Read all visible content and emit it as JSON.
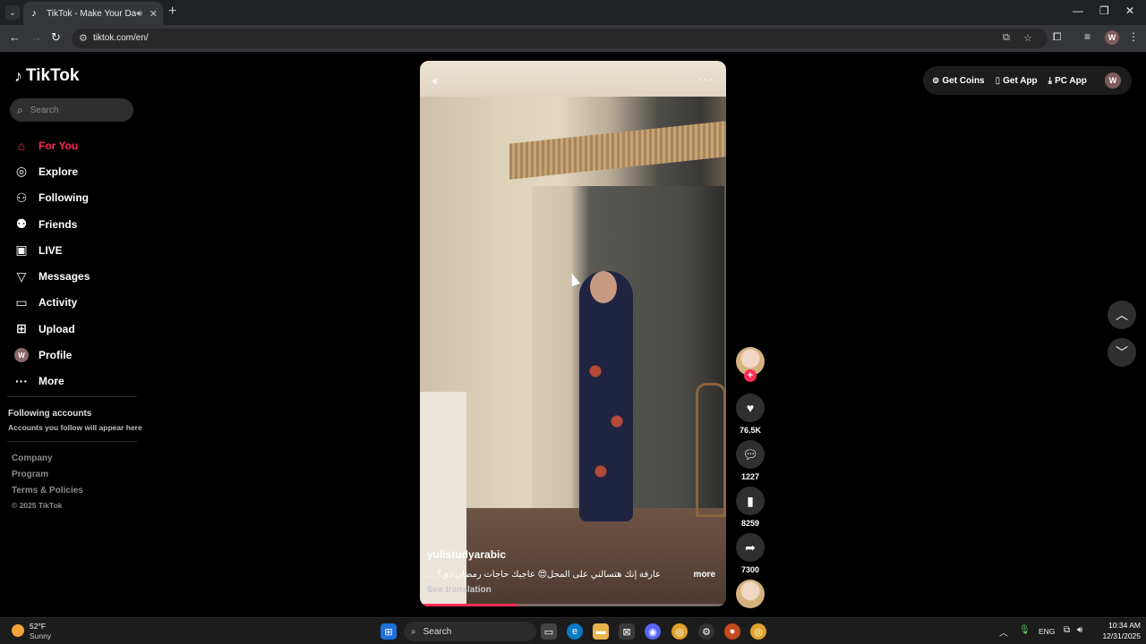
{
  "browser": {
    "tab_title": "TikTok - Make Your Day",
    "url": "tiktok.com/en/",
    "profile_initial": "W"
  },
  "sidebar": {
    "logo": "TikTok",
    "search_placeholder": "Search",
    "nav": [
      {
        "label": "For You",
        "icon": "home-icon",
        "active": true
      },
      {
        "label": "Explore",
        "icon": "compass-icon"
      },
      {
        "label": "Following",
        "icon": "user-follow-icon"
      },
      {
        "label": "Friends",
        "icon": "friends-icon"
      },
      {
        "label": "LIVE",
        "icon": "live-icon"
      },
      {
        "label": "Messages",
        "icon": "send-icon"
      },
      {
        "label": "Activity",
        "icon": "inbox-icon"
      },
      {
        "label": "Upload",
        "icon": "plus-square-icon"
      },
      {
        "label": "Profile",
        "icon": "avatar",
        "initial": "W"
      },
      {
        "label": "More",
        "icon": "dots-icon"
      }
    ],
    "following_title": "Following accounts",
    "following_sub": "Accounts you follow will appear here",
    "footer": [
      "Company",
      "Program",
      "Terms & Policies"
    ],
    "copyright": "© 2025 TikTok"
  },
  "video": {
    "author": "yulistudyarabic",
    "caption": "عارفة إنك هتسألني على المحل😍 عاجبك حاجات رمضان دي؟ ...",
    "more": "more",
    "see_translation": "See translation",
    "progress": 0.32
  },
  "actions": {
    "likes": "76.5K",
    "comments": "1227",
    "saves": "8259",
    "shares": "7300"
  },
  "topbar": {
    "get_coins": "Get Coins",
    "get_app": "Get App",
    "pc_app": "PC App",
    "avatar_initial": "W"
  },
  "taskbar": {
    "temp": "52°F",
    "weather": "Sunny",
    "search": "Search",
    "lang": "ENG",
    "time": "10:34 AM",
    "date": "12/31/2025"
  },
  "colors": {
    "accent": "#fe2c55"
  }
}
